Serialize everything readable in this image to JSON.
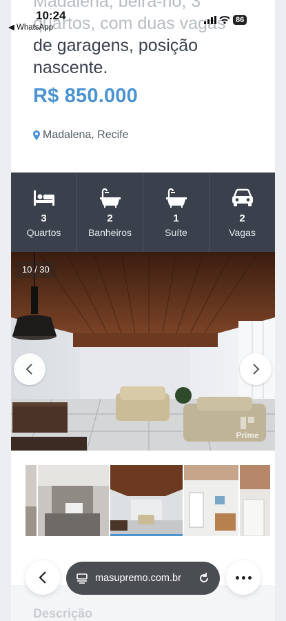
{
  "status_bar": {
    "time": "10:24",
    "back_app": "◀ WhatsApp",
    "battery": "86"
  },
  "listing": {
    "title_lines": [
      "Madalena, beira-rio, 3",
      "quartos, com duas vagas",
      "de garagens, posição",
      "nascente."
    ],
    "price": "R$ 850.000",
    "location": "Madalena, Recife"
  },
  "features": [
    {
      "icon": "bed-icon",
      "value": "3",
      "label": "Quartos"
    },
    {
      "icon": "bathtub-icon",
      "value": "2",
      "label": "Banheiros"
    },
    {
      "icon": "bathtub-icon",
      "value": "1",
      "label": "Suíte"
    },
    {
      "icon": "car-icon",
      "value": "2",
      "label": "Vagas"
    }
  ],
  "gallery": {
    "counter": "10 / 30",
    "watermark": "Prime",
    "current_index": 10,
    "total": 30
  },
  "browser": {
    "url": "masupremo.com.br"
  },
  "section": {
    "description_heading": "Descrição"
  }
}
